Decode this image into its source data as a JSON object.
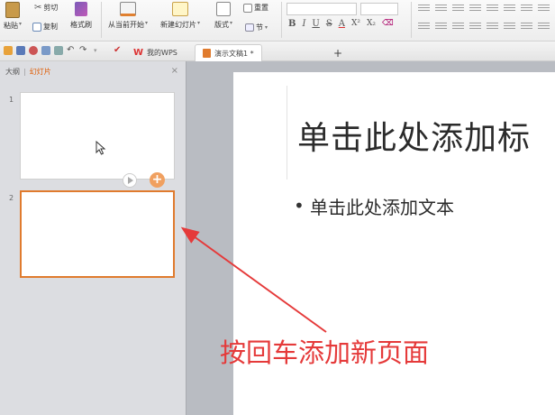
{
  "ribbon": {
    "paste_label": "粘贴",
    "cut_label": "剪切",
    "copy_label": "复制",
    "format_painter_label": "格式刷",
    "from_current_label": "从当前开始",
    "new_slide_label": "新建幻灯片",
    "layout_label": "版式",
    "section_label": "节",
    "reset_label": "重置"
  },
  "tabs": {
    "wps_tab": "我的WPS",
    "doc_tab": "演示文稿1 *",
    "add_tab": "+"
  },
  "panel": {
    "outline_tab": "大纲",
    "slides_tab": "幻灯片",
    "close": "×",
    "slide1_number": "1",
    "slide2_number": "2"
  },
  "slide": {
    "title_placeholder": "单击此处添加标",
    "bullet": "•",
    "body_placeholder": "单击此处添加文本"
  },
  "annotation": {
    "text": "按回车添加新页面"
  },
  "colors": {
    "accent_orange": "#e07b2e",
    "annotation_red": "#e53a3a"
  }
}
